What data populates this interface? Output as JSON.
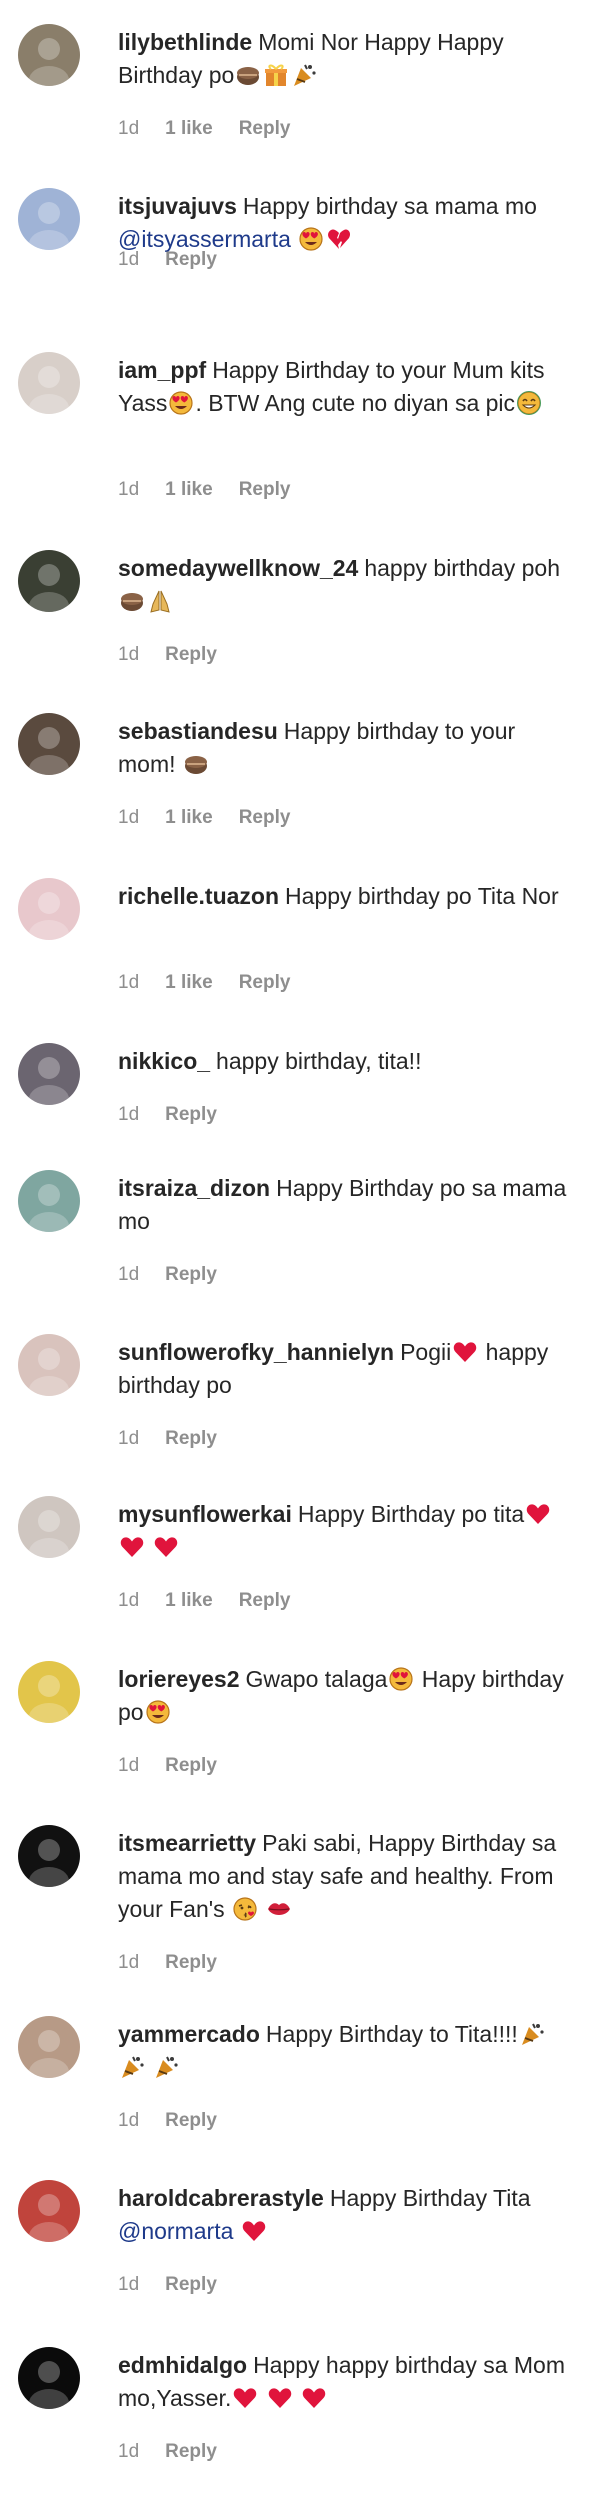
{
  "comments": [
    {
      "username": "lilybethlinde",
      "text_parts": [
        {
          "t": "Momi Nor Happy Happy Birthday po"
        },
        {
          "e": "cake"
        },
        {
          "e": "gift"
        },
        {
          "e": "party"
        }
      ],
      "time": "1d",
      "likes": "1 like",
      "reply": "Reply",
      "avatar_color": "#8a7e6a"
    },
    {
      "username": "itsjuvajuvs",
      "text_parts": [
        {
          "t": "Happy birthday sa mama mo "
        },
        {
          "m": "@itsyassermarta"
        },
        {
          "t": " "
        },
        {
          "e": "heart-eyes"
        },
        {
          "e": "heart-broken"
        }
      ],
      "time": "1d",
      "likes": "",
      "reply": "Reply",
      "avatar_color": "#9fb3d6"
    },
    {
      "username": "iam_ppf",
      "text_parts": [
        {
          "t": "Happy Birthday to your Mum kits Yass"
        },
        {
          "e": "heart-eyes"
        },
        {
          "t": ". BTW Ang cute no diyan sa pic"
        },
        {
          "e": "smile"
        }
      ],
      "time": "1d",
      "likes": "1 like",
      "reply": "Reply",
      "avatar_color": "#d8cfc9"
    },
    {
      "username": "somedaywellknow_24",
      "text_parts": [
        {
          "t": "happy birthday poh "
        },
        {
          "e": "cake"
        },
        {
          "e": "pray"
        }
      ],
      "time": "1d",
      "likes": "",
      "reply": "Reply",
      "avatar_color": "#3a3f33"
    },
    {
      "username": "sebastiandesu",
      "text_parts": [
        {
          "t": "Happy birthday to your mom! "
        },
        {
          "e": "cake"
        }
      ],
      "time": "1d",
      "likes": "1 like",
      "reply": "Reply",
      "avatar_color": "#5a4a3e"
    },
    {
      "username": "richelle.tuazon",
      "text_parts": [
        {
          "t": "Happy birthday po Tita Nor"
        }
      ],
      "time": "1d",
      "likes": "1 like",
      "reply": "Reply",
      "avatar_color": "#e8c8cc"
    },
    {
      "username": "nikkico_",
      "text_parts": [
        {
          "t": "happy birthday, tita!!"
        }
      ],
      "time": "1d",
      "likes": "",
      "reply": "Reply",
      "avatar_color": "#6b6570"
    },
    {
      "username": "itsraiza_dizon",
      "text_parts": [
        {
          "t": "Happy Birthday po sa mama mo"
        }
      ],
      "time": "1d",
      "likes": "",
      "reply": "Reply",
      "avatar_color": "#7fa6a0"
    },
    {
      "username": "sunflowerofky_hannielyn",
      "text_parts": [
        {
          "t": "Pogii"
        },
        {
          "e": "heart"
        },
        {
          "t": " happy birthday po"
        }
      ],
      "time": "1d",
      "likes": "",
      "reply": "Reply",
      "avatar_color": "#d9c3bd"
    },
    {
      "username": "mysunflowerkai",
      "text_parts": [
        {
          "t": "Happy Birthday po tita"
        },
        {
          "e": "heart"
        },
        {
          "t": " "
        },
        {
          "e": "heart"
        },
        {
          "t": " "
        },
        {
          "e": "heart"
        }
      ],
      "time": "1d",
      "likes": "1 like",
      "reply": "Reply",
      "avatar_color": "#cfc6c0"
    },
    {
      "username": "loriereyes2",
      "text_parts": [
        {
          "t": "Gwapo talaga"
        },
        {
          "e": "heart-eyes"
        },
        {
          "t": " Hapy birthday po"
        },
        {
          "e": "heart-eyes"
        }
      ],
      "time": "1d",
      "likes": "",
      "reply": "Reply",
      "avatar_color": "#e2c54a"
    },
    {
      "username": "itsmearrietty",
      "text_parts": [
        {
          "t": "Paki sabi, Happy Birthday sa mama mo and stay safe and healthy. From your Fan's "
        },
        {
          "e": "kiss"
        },
        {
          "t": " "
        },
        {
          "e": "lips"
        }
      ],
      "time": "1d",
      "likes": "",
      "reply": "Reply",
      "avatar_color": "#111111"
    },
    {
      "username": "yammercado",
      "text_parts": [
        {
          "t": "Happy Birthday to Tita!!!!"
        },
        {
          "e": "party"
        },
        {
          "t": " "
        },
        {
          "e": "party"
        },
        {
          "t": " "
        },
        {
          "e": "party"
        }
      ],
      "time": "1d",
      "likes": "",
      "reply": "Reply",
      "avatar_color": "#b79a86"
    },
    {
      "username": "haroldcabrerastyle",
      "text_parts": [
        {
          "t": "Happy Birthday Tita "
        },
        {
          "m": "@normarta"
        },
        {
          "t": " "
        },
        {
          "e": "heart"
        }
      ],
      "time": "1d",
      "likes": "",
      "reply": "Reply",
      "avatar_color": "#c0443c"
    },
    {
      "username": "edmhidalgo",
      "text_parts": [
        {
          "t": "Happy happy birthday sa Mom mo,Yasser."
        },
        {
          "e": "heart"
        },
        {
          "t": " "
        },
        {
          "e": "heart"
        },
        {
          "t": " "
        },
        {
          "e": "heart"
        }
      ],
      "time": "1d",
      "likes": "",
      "reply": "Reply",
      "avatar_color": "#0b0b0b"
    }
  ],
  "colors": {
    "text": "#262626",
    "meta": "#8e8e8e",
    "mention": "#1e3a8a",
    "heart": "#e0143c"
  }
}
